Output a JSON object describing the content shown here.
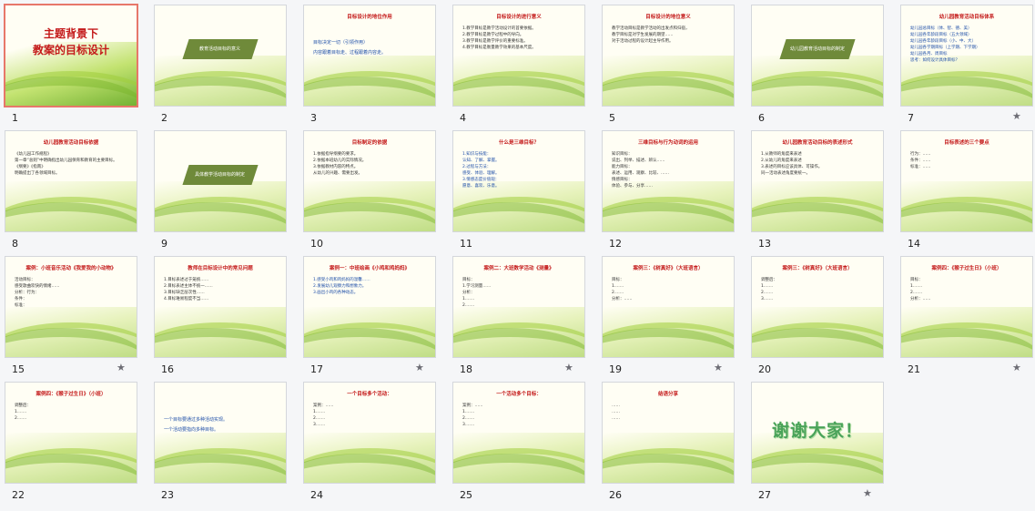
{
  "colors": {
    "selected_border": "#e7776a",
    "title_red": "#c41a1a",
    "ribbon": "#6f8a3a",
    "thanks_green": "#4aa35a"
  },
  "slides": [
    {
      "num": "1",
      "kind": "title",
      "title": "主题背景下\n教案的目标设计",
      "star": false,
      "selected": true
    },
    {
      "num": "2",
      "kind": "ribbon",
      "ribbon": "教育活动目标的意义",
      "star": false
    },
    {
      "num": "3",
      "kind": "text",
      "title": "目标设计的地位作用",
      "lines": "目标决定一切（引领作用）\n内容跟着目标走、过程跟着内容走。",
      "style": "bigtxt blue",
      "star": false
    },
    {
      "num": "4",
      "kind": "text",
      "title": "目标设计的进行意义",
      "lines": "1.教学目标是教学活动设计的首要依据。\n2.教学目标是教学过程中的导向。\n3.教学目标是教学评价的重要标准。\n4.教学目标是衡量教学效果的基本尺度。",
      "style": "",
      "star": false
    },
    {
      "num": "5",
      "kind": "text",
      "title": "目标设计的地位意义",
      "lines": "教学活动目标是教学活动的出发点和归宿，\n教学目标是对学生发展的期望……\n对于活动过程的设计起主导作用。",
      "style": "",
      "star": false
    },
    {
      "num": "6",
      "kind": "ribbon",
      "ribbon": "幼儿园教育活动目标的制定",
      "star": false
    },
    {
      "num": "7",
      "kind": "text",
      "title": "幼儿园教育活动目标体系",
      "lines": "幼儿园总目标（体、智、德、美）\n幼儿园各年龄段目标（五大领域）\n幼儿园各年龄段目标（小、中、大）\n幼儿园各学期目标（上学期、下学期）\n幼儿园各月、周目标\n思考：如何设计具体目标？",
      "style": "blue",
      "star": true
    },
    {
      "num": "8",
      "kind": "text",
      "title": "幼儿园教育活动目标依据",
      "lines": "《幼儿园工作规程》\n第一章“总则”中明确指出幼儿园保育和教育的主要目标。\n《纲要》《指南》\n明确提出了各领域目标。",
      "style": "",
      "star": false
    },
    {
      "num": "9",
      "kind": "ribbon",
      "ribbon": "具体教学活动目标的制定",
      "star": false
    },
    {
      "num": "10",
      "kind": "text",
      "title": "目标制定的依据",
      "lines": "1.依据指导纲要的要求。\n2.依据本班幼儿的实际情况。\n3.依据教材内容的特点。\n从幼儿的兴趣、需要出发。",
      "style": "",
      "star": false
    },
    {
      "num": "11",
      "kind": "text",
      "title": "什么是三维目标？",
      "lines": "1.知识与技能：\n认知、了解、掌握。\n2.过程与方法：\n感受、体验、理解。\n3.情感态度价值观：\n愿意、喜欢、乐意。",
      "style": "blue",
      "star": false
    },
    {
      "num": "12",
      "kind": "text",
      "title": "三维目标与行为动词的运用",
      "lines": "知识目标：\n说出、列举、描述、辨认……\n能力目标：\n表述、运用、观察、比较、……\n情感目标：\n体验、参与、分享……",
      "style": "",
      "star": false
    },
    {
      "num": "13",
      "kind": "text",
      "title": "幼儿园教育活动目标的表述形式",
      "lines": "1.从教师的角度来表述\n2.从幼儿的角度来表述\n3.表述的目标应该具体、可操作。\n同一活动表述角度要统一。",
      "style": "",
      "star": false
    },
    {
      "num": "14",
      "kind": "text",
      "title": "目标表述的三个要点",
      "lines": "行为：……\n条件：……\n标准：……",
      "style": "",
      "star": false
    },
    {
      "num": "15",
      "kind": "text",
      "title": "案例：小班音乐活动《我爱我的小动物》",
      "lines": "活动目标：\n感受歌曲欢快的情绪……\n分析：行为：\n条件：\n标准：",
      "style": "",
      "star": true
    },
    {
      "num": "16",
      "kind": "text",
      "title": "教师在目标设计中的常见问题",
      "lines": "1.目标表述过于笼统……\n2.目标表述主体不统一……\n3.目标缺乏层次性……\n4.目标难易程度不当……",
      "style": "",
      "star": false
    },
    {
      "num": "17",
      "kind": "text",
      "title": "案例一：中班绘画《小鸡和鸡妈妈》",
      "lines": "1.感受小鸡和鸡妈妈的温馨……\n2.发展幼儿观察力和想象力。\n3.画出小鸡的各种动态。",
      "style": "blue",
      "star": true
    },
    {
      "num": "18",
      "kind": "text",
      "title": "案例二：大班数学活动《测量》",
      "lines": "目标：\n1.学习测量……\n分析：\n1.……\n2.……",
      "style": "",
      "star": true
    },
    {
      "num": "19",
      "kind": "text",
      "title": "案例三：《树真好》（大班语言）",
      "lines": "目标：\n1.……\n2.……\n分析：……",
      "style": "",
      "star": true
    },
    {
      "num": "20",
      "kind": "text",
      "title": "案例三：《树真好》（大班语言）",
      "lines": "调整后：\n1.……\n2.……\n3.……",
      "style": "",
      "star": false
    },
    {
      "num": "21",
      "kind": "text",
      "title": "案例四：《猴子过生日》（小班）",
      "lines": "目标：\n1.……\n2.……\n分析：……",
      "style": "",
      "star": true
    },
    {
      "num": "22",
      "kind": "text",
      "title": "案例四：《猴子过生日》（小班）",
      "lines": "调整后：\n1.……\n2.……",
      "style": "",
      "star": false
    },
    {
      "num": "23",
      "kind": "text",
      "title": "",
      "lines": "一个目标要通过多种活动实现。\n一个活动要指向多种目标。",
      "style": "bigtxt blue",
      "star": false
    },
    {
      "num": "24",
      "kind": "text",
      "title": "一个目标多个活动：",
      "lines": "案例：……\n1.……\n2.……\n3.……",
      "style": "",
      "star": false
    },
    {
      "num": "25",
      "kind": "text",
      "title": "一个活动多个目标：",
      "lines": "案例：……\n1.……\n2.……\n3.……",
      "style": "",
      "star": false
    },
    {
      "num": "26",
      "kind": "text",
      "title": "结语分享",
      "lines": "……\n……\n……",
      "style": "",
      "star": false
    },
    {
      "num": "27",
      "kind": "thanks",
      "thanks": "谢谢大家！",
      "star": true
    }
  ]
}
